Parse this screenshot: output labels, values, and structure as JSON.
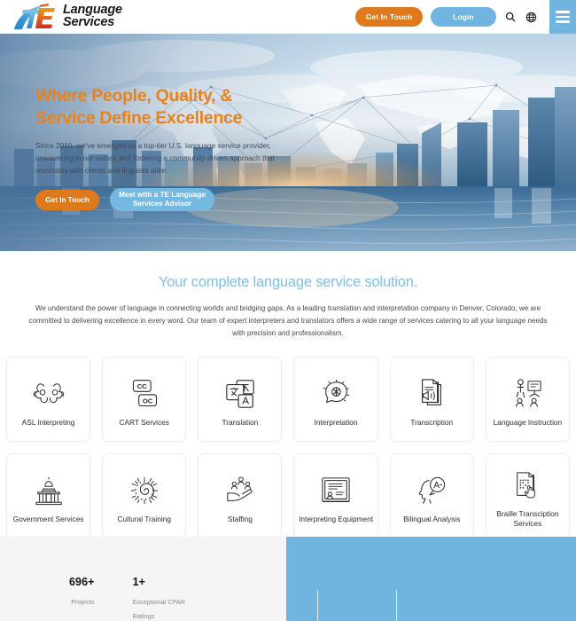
{
  "header": {
    "logo": {
      "mark": "te-monogram-icon",
      "line1": "Language",
      "line2": "Services"
    },
    "get_in_touch_label": "Get In Touch",
    "login_label": "Login",
    "search_icon": "search-icon",
    "language_icon": "globe-icon",
    "menu_icon": "hamburger-menu-icon"
  },
  "hero": {
    "title_line1": "Where People, Quality, &",
    "title_line2": "Service Define Excellence",
    "subtitle": "Since 2010, we've emerged as a top-tier U.S. language service provider, unwavering in our values and fostering a community-driven approach that resonates with clients and linguists alike.",
    "cta_primary": "Get In Touch",
    "cta_secondary": "Meet with a TE Language Services Advisor"
  },
  "solution": {
    "title": "Your complete language service solution.",
    "description": "We understand the power of language in connecting worlds and bridging gaps. As a leading translation and interpretation company in Denver, Colorado, we are committed to delivering excellence in every word. Our team of expert interpreters and translators offers a wide range of services catering to all your language needs with precision and professionalism."
  },
  "services": [
    {
      "label": "ASL Interpreting",
      "icon": "signing-hands-icon"
    },
    {
      "label": "CART Services",
      "icon": "closed-caption-icon"
    },
    {
      "label": "Translation",
      "icon": "translate-documents-icon"
    },
    {
      "label": "Interpretation",
      "icon": "speech-brain-icon"
    },
    {
      "label": "Transcription",
      "icon": "audio-document-icon"
    },
    {
      "label": "Language Instruction",
      "icon": "classroom-teaching-icon"
    },
    {
      "label": "Government Services",
      "icon": "capitol-building-icon"
    },
    {
      "label": "Cultural Training",
      "icon": "spiral-sun-icon"
    },
    {
      "label": "Staffing",
      "icon": "hand-with-people-icon"
    },
    {
      "label": "Interpreting Equipment",
      "icon": "presentation-screen-icon"
    },
    {
      "label": "Bilingual Analysis",
      "icon": "head-speech-bubble-icon"
    },
    {
      "label": "Braille Transciption Services",
      "icon": "braille-page-hand-icon"
    }
  ],
  "stats": [
    {
      "number": "696+",
      "label": "Projects"
    },
    {
      "number": "1+",
      "label": "Exceptional CPAR Ratings"
    }
  ],
  "colors": {
    "orange": "#DE7A1C",
    "blue": "#6FB5DF",
    "heading_blue": "#7FC0E8",
    "hero_title_orange": "#E8821C",
    "stats_bg": "#F5F5F5"
  }
}
